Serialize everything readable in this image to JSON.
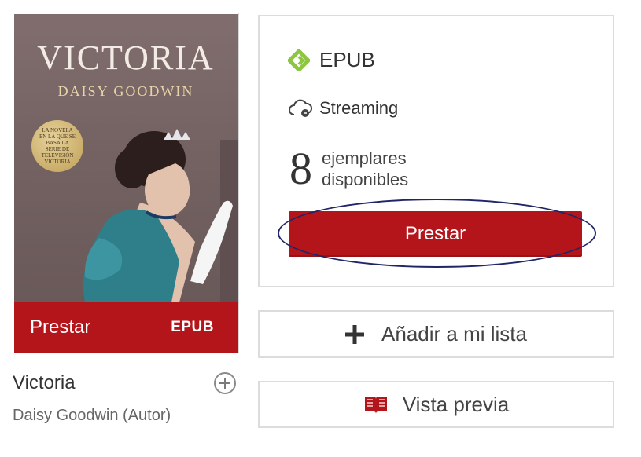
{
  "book": {
    "cover": {
      "title": "VICTORIA",
      "author": "DAISY GOODWIN",
      "seal_text": "LA NOVELA EN LA QUE SE BASA LA SERIE DE TELEVISIÓN VICTORIA"
    },
    "cover_bar": {
      "lend_label": "Prestar",
      "format_label": "EPUB"
    },
    "title": "Victoria",
    "author": "Daisy Goodwin (Autor)"
  },
  "availability": {
    "format": "EPUB",
    "streaming": "Streaming",
    "copies_count": "8",
    "copies_label_line1": "ejemplares",
    "copies_label_line2": "disponibles",
    "lend_button": "Prestar"
  },
  "actions": {
    "add_to_list": "Añadir a mi lista",
    "preview": "Vista previa"
  },
  "colors": {
    "accent_red": "#b3151b",
    "epub_green": "#8dc63f",
    "highlight_navy": "#1f2566"
  }
}
